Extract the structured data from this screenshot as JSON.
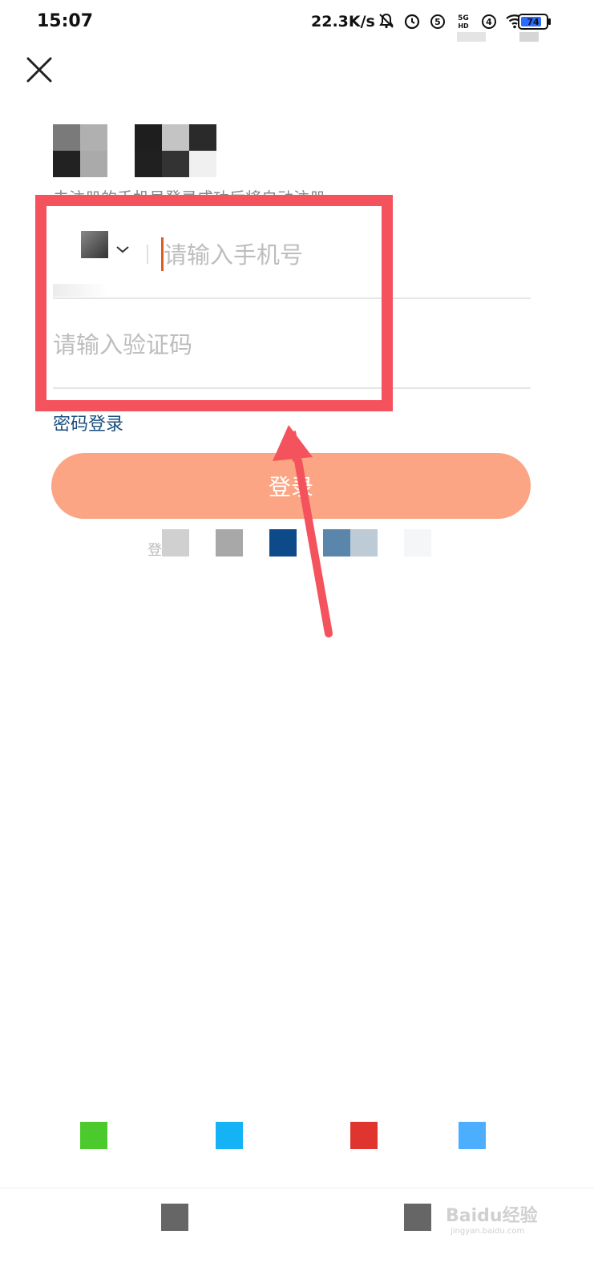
{
  "status_bar": {
    "time": "15:07",
    "net_speed": "22.3K/s",
    "battery_level": "74",
    "icons": [
      "bell-muted-icon",
      "alarm-icon",
      "sim-5-icon",
      "5g-hd-icon",
      "sim-4-icon",
      "wifi-icon",
      "battery-icon"
    ]
  },
  "header": {
    "close_icon": "close-icon",
    "subtitle": "未注册的手机号登录成功后将自动注册"
  },
  "form": {
    "phone_placeholder": "请输入手机号",
    "code_placeholder": "请输入验证码",
    "country_selector_icon": "chevron-down-icon",
    "password_login_link": "密码登录",
    "login_button": "登录",
    "agreement_prefix": "登"
  },
  "social_login": {
    "icons": [
      "wechat-icon",
      "qq-icon",
      "weibo-icon",
      "alipay-icon"
    ],
    "colors": [
      "#4cca2d",
      "#15b2f5",
      "#e0352f",
      "#4baeff"
    ]
  },
  "annotation": {
    "highlight_color": "#f4535d"
  },
  "watermark": {
    "brand": "Baidu经验",
    "url": "jingyan.baidu.com"
  },
  "colors": {
    "login_button_bg": "#fba584",
    "link_color": "#1a4e7d",
    "caret_color": "#e05a20"
  }
}
